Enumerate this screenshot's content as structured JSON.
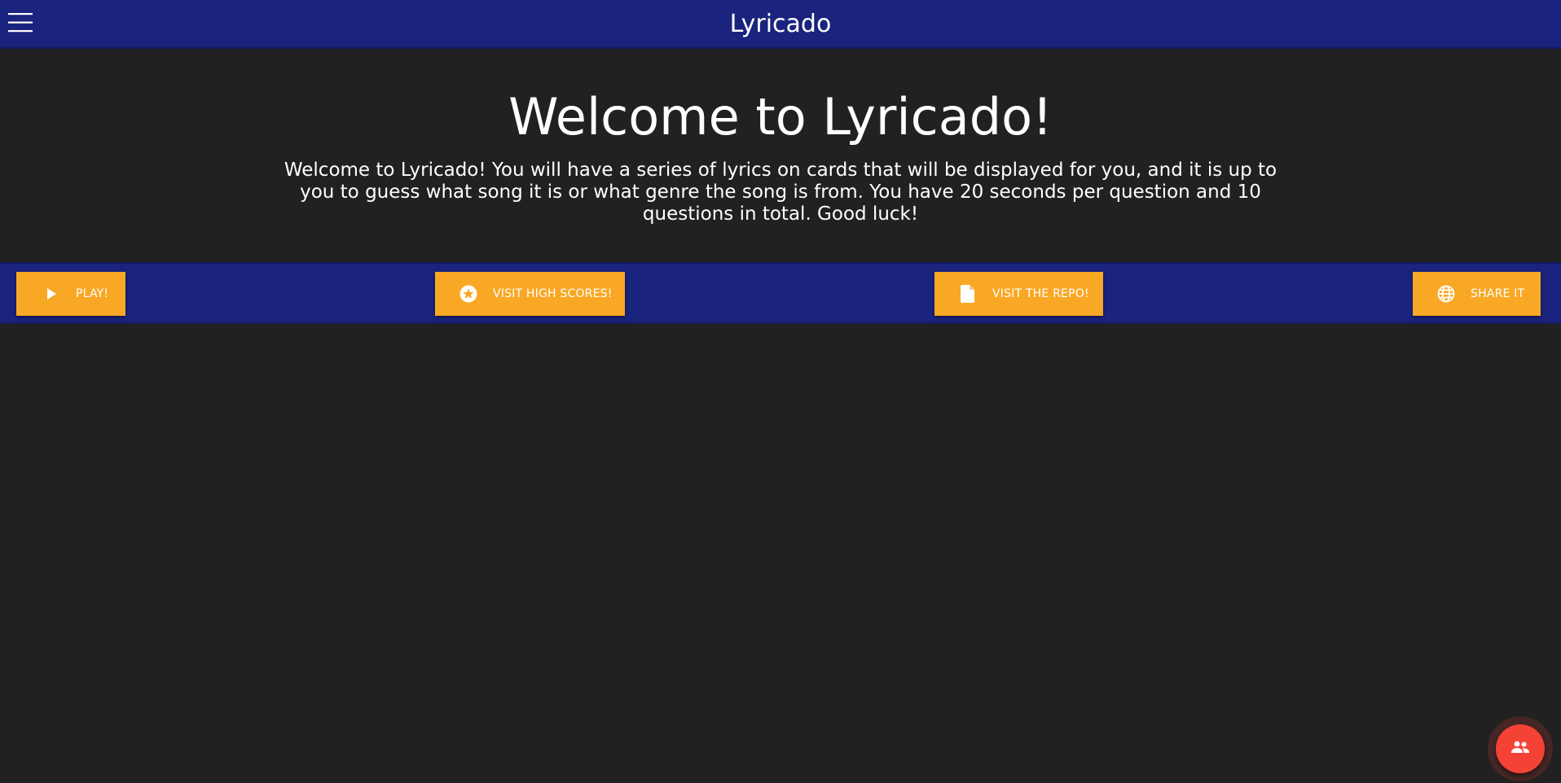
{
  "header": {
    "title": "Lyricado",
    "menu_icon": "hamburger-menu-icon",
    "background_color": "#1a237e"
  },
  "hero": {
    "heading": "Welcome to Lyricado!",
    "description": "Welcome to Lyricado! You will have a series of lyrics on cards that will be displayed for you, and it is up to you to guess what song it is or what genre the song is from. You have 20 seconds per question and 10 questions in total. Good luck!"
  },
  "actions": {
    "play": {
      "label": "PLAY!",
      "icon": "play-icon"
    },
    "high_scores": {
      "label": "VISIT HIGH SCORES!",
      "icon": "star-circle-icon"
    },
    "repo": {
      "label": "VISIT THE REPO!",
      "icon": "file-icon"
    },
    "share": {
      "label": "SHARE IT",
      "icon": "globe-icon"
    }
  },
  "fab": {
    "icon": "people-icon",
    "color": "#f44336"
  },
  "colors": {
    "page_background": "#212121",
    "accent": "#f9a825",
    "primary": "#1a237e"
  }
}
